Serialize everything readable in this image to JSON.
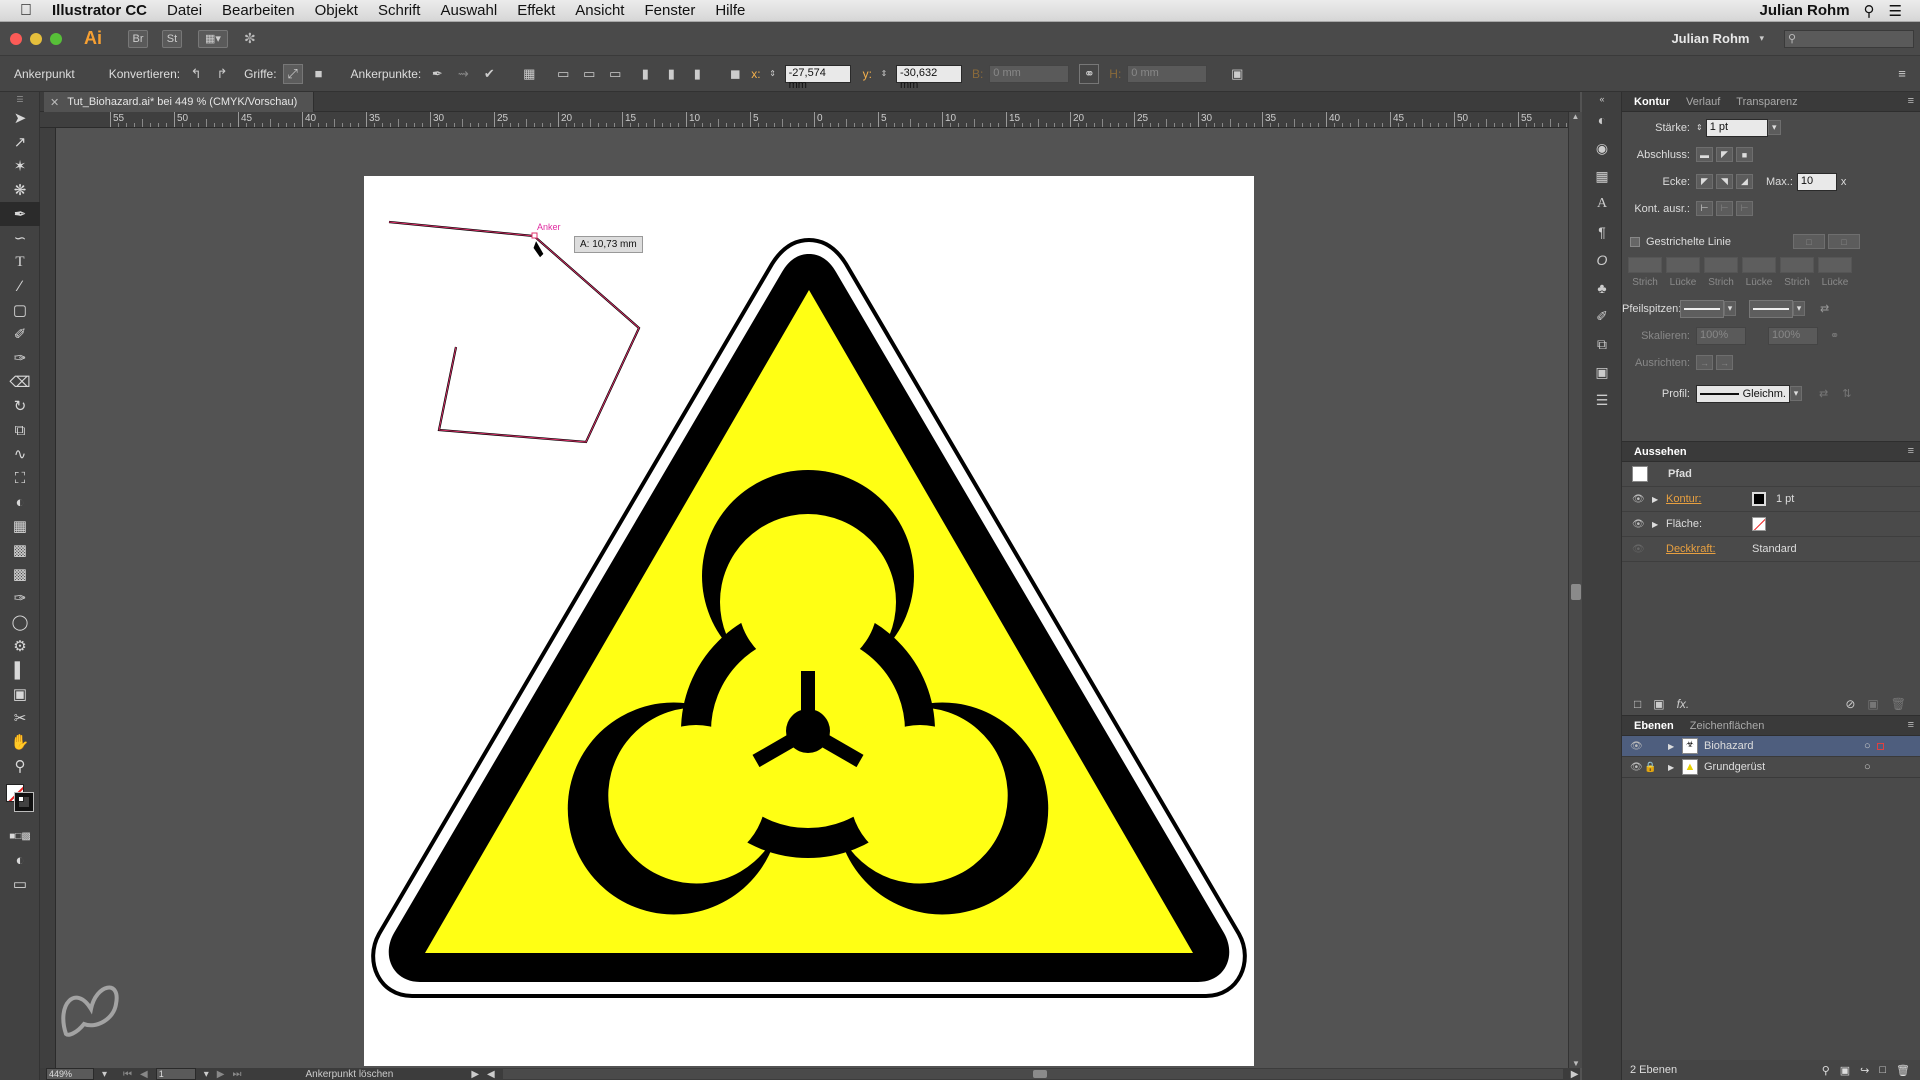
{
  "menubar": {
    "app": "Illustrator CC",
    "items": [
      "Datei",
      "Bearbeiten",
      "Objekt",
      "Schrift",
      "Auswahl",
      "Effekt",
      "Ansicht",
      "Fenster",
      "Hilfe"
    ],
    "user": "Julian Rohm"
  },
  "appbar": {
    "logo": "Ai",
    "bridge": "Br",
    "stock": "St",
    "user": "Julian Rohm"
  },
  "control": {
    "mode": "Ankerpunkt",
    "convert": "Konvertieren:",
    "handles": "Griffe:",
    "anchors": "Ankerpunkte:",
    "x_label": "x:",
    "x_value": "-27,574 mm",
    "y_label": "y:",
    "y_value": "-30,632 mm",
    "b_label": "B:",
    "b_value": "0 mm",
    "h_label": "H:",
    "h_value": "0 mm"
  },
  "document": {
    "tab_title": "Tut_Biohazard.ai* bei 449 % (CMYK/Vorschau)",
    "ruler_labels": [
      "55",
      "50",
      "45",
      "40",
      "35",
      "30",
      "25",
      "20",
      "15",
      "10",
      "5",
      "0",
      "5",
      "10",
      "15",
      "20",
      "25",
      "30",
      "35",
      "40",
      "45",
      "50",
      "55"
    ],
    "anchor_hint": "Anker",
    "tooltip": "A: 10,73 mm"
  },
  "status": {
    "zoom": "449%",
    "page": "1",
    "message": "Ankerpunkt löschen"
  },
  "kontur_panel": {
    "tabs": [
      "Kontur",
      "Verlauf",
      "Transparenz"
    ],
    "staerke_label": "Stärke:",
    "staerke_value": "1 pt",
    "abschluss_label": "Abschluss:",
    "ecke_label": "Ecke:",
    "max_label": "Max.:",
    "max_value": "10",
    "max_unit": "x",
    "kont_label": "Kont. ausr.:",
    "dashed_label": "Gestrichelte Linie",
    "dash_labels": [
      "Strich",
      "Lücke",
      "Strich",
      "Lücke",
      "Strich",
      "Lücke"
    ],
    "pfeil_label": "Pfeilspitzen:",
    "skalieren_label": "Skalieren:",
    "skalieren_a": "100%",
    "skalieren_b": "100%",
    "ausrichten_label": "Ausrichten:",
    "profil_label": "Profil:",
    "profil_value": "Gleichm."
  },
  "aussehen_panel": {
    "title": "Aussehen",
    "object": "Pfad",
    "kontur_label": "Kontur:",
    "kontur_value": "1 pt",
    "flaeche_label": "Fläche:",
    "deckkraft_label": "Deckkraft:",
    "deckkraft_value": "Standard",
    "fx": "fx."
  },
  "ebenen_panel": {
    "tabs": [
      "Ebenen",
      "Zeichenflächen"
    ],
    "layers": [
      {
        "name": "Biohazard"
      },
      {
        "name": "Grundgerüst"
      }
    ],
    "count": "2 Ebenen"
  },
  "colors": {
    "sign_yellow": "#ffff14",
    "sign_black": "#000000",
    "path_pink": "#e0306a",
    "accent_orange": "#e8a040",
    "selected_layer": "#4e5e7e"
  }
}
